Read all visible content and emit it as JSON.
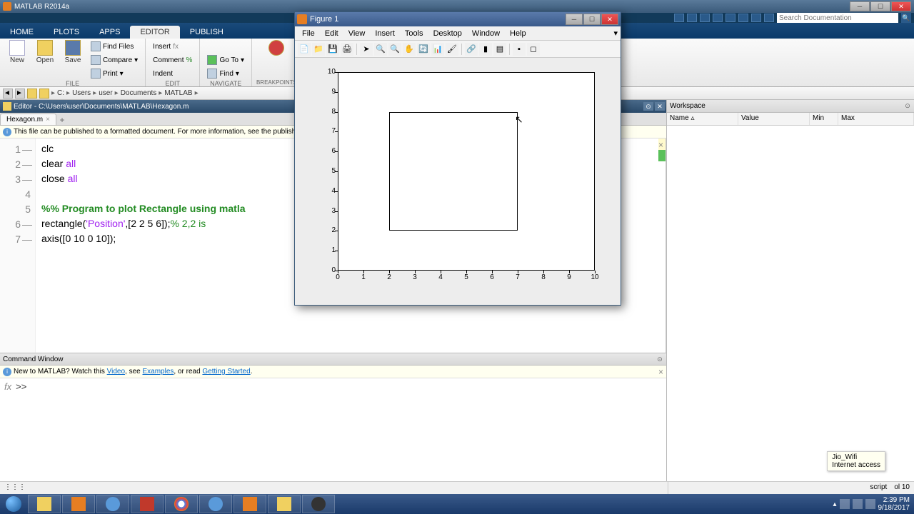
{
  "app": {
    "title": "MATLAB R2014a"
  },
  "tabs": {
    "home": "HOME",
    "plots": "PLOTS",
    "apps": "APPS",
    "editor": "EDITOR",
    "publish": "PUBLISH"
  },
  "toolstrip": {
    "file": {
      "new": "New",
      "open": "Open",
      "save": "Save",
      "find_files": "Find Files",
      "compare": "Compare",
      "print": "Print",
      "label": "FILE"
    },
    "edit": {
      "insert": "Insert",
      "comment": "Comment",
      "indent": "Indent",
      "label": "EDIT"
    },
    "navigate": {
      "goto": "Go To",
      "find": "Find",
      "label": "NAVIGATE"
    },
    "breakpoints": {
      "label": "BREAKPOINTS"
    }
  },
  "search": {
    "placeholder": "Search Documentation"
  },
  "path": {
    "drive": "C:",
    "p1": "Users",
    "p2": "user",
    "p3": "Documents",
    "p4": "MATLAB"
  },
  "editor": {
    "title": "Editor - C:\\Users\\user\\Documents\\MATLAB\\Hexagon.m",
    "filetab": "Hexagon.m",
    "infobar": "This file can be published to a formatted document. For more information, see the publishing",
    "code": {
      "l1a": "clc",
      "l2a": "clear ",
      "l2b": "all",
      "l3a": "close ",
      "l3b": "all",
      "l5": "%% Program to plot Rectangle using matla",
      "l6a": "rectangle(",
      "l6b": "'Position'",
      "l6c": ",[2 2 5 6]);",
      "l6d": "% 2,2 is",
      "l7": "axis([0 10 0 10]);"
    }
  },
  "cmdwin": {
    "title": "Command Window",
    "info_a": "New to MATLAB? Watch this ",
    "info_video": "Video",
    "info_b": ", see ",
    "info_examples": "Examples",
    "info_c": ", or read ",
    "info_gs": "Getting Started",
    "info_d": ".",
    "fx": "fx",
    "prompt": ">>"
  },
  "workspace": {
    "title": "Workspace",
    "cols": {
      "name": "Name",
      "value": "Value",
      "min": "Min",
      "max": "Max"
    }
  },
  "status": {
    "script": "script",
    "col": "ol  10"
  },
  "tooltip": {
    "line1": "Jio_Wifi",
    "line2": "Internet access"
  },
  "figure": {
    "title": "Figure 1",
    "menus": {
      "file": "File",
      "edit": "Edit",
      "view": "View",
      "insert": "Insert",
      "tools": "Tools",
      "desktop": "Desktop",
      "window": "Window",
      "help": "Help"
    }
  },
  "chart_data": {
    "type": "rectangle-plot",
    "xlim": [
      0,
      10
    ],
    "ylim": [
      0,
      10
    ],
    "xticks": [
      0,
      1,
      2,
      3,
      4,
      5,
      6,
      7,
      8,
      9,
      10
    ],
    "yticks": [
      0,
      1,
      2,
      3,
      4,
      5,
      6,
      7,
      8,
      9,
      10
    ],
    "rectangle": {
      "x": 2,
      "y": 2,
      "width": 5,
      "height": 6
    }
  },
  "tray": {
    "time": "2:39 PM",
    "date": "9/18/2017"
  }
}
